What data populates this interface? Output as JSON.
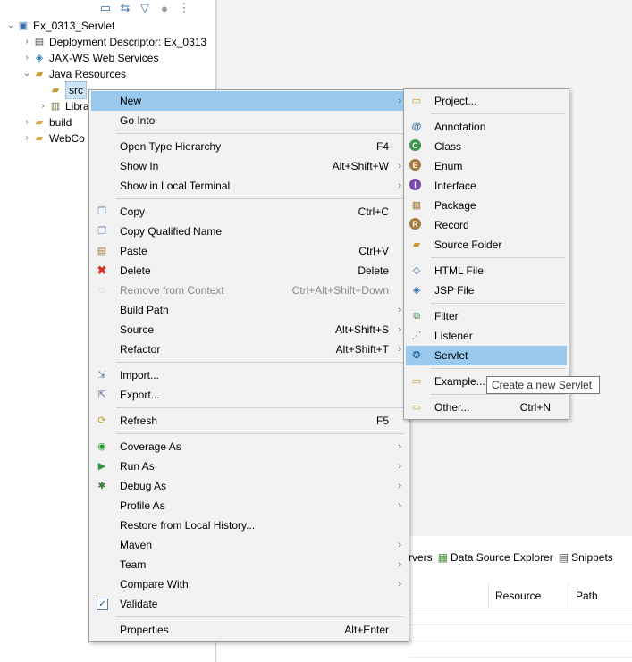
{
  "toolbar": {
    "icons": [
      "collapse-all-icon",
      "link-editor-icon",
      "filter-icon",
      "tree-icon",
      "view-menu-icon"
    ]
  },
  "tree": {
    "project": "Ex_0313_Servlet",
    "items": [
      {
        "label": "Deployment Descriptor: Ex_0313",
        "icon": "deployment-descriptor-icon"
      },
      {
        "label": "JAX-WS Web Services",
        "icon": "web-services-icon"
      },
      {
        "label": "Java Resources",
        "icon": "java-resources-icon"
      },
      {
        "label": "src",
        "icon": "package-folder-icon"
      },
      {
        "label": "Libra",
        "icon": "libraries-icon"
      },
      {
        "label": "build",
        "icon": "folder-icon"
      },
      {
        "label": "WebCo",
        "icon": "folder-icon"
      }
    ]
  },
  "context_menu": {
    "items": [
      {
        "label": "New",
        "shortcut": "",
        "submenu": true
      },
      {
        "label": "Go Into",
        "shortcut": ""
      },
      {
        "label": "Open Type Hierarchy",
        "shortcut": "F4"
      },
      {
        "label": "Show In",
        "shortcut": "Alt+Shift+W",
        "submenu": true
      },
      {
        "label": "Show in Local Terminal",
        "shortcut": "",
        "submenu": true
      },
      {
        "label": "Copy",
        "shortcut": "Ctrl+C"
      },
      {
        "label": "Copy Qualified Name",
        "shortcut": ""
      },
      {
        "label": "Paste",
        "shortcut": "Ctrl+V"
      },
      {
        "label": "Delete",
        "shortcut": "Delete"
      },
      {
        "label": "Remove from Context",
        "shortcut": "Ctrl+Alt+Shift+Down",
        "disabled": true
      },
      {
        "label": "Build Path",
        "shortcut": "",
        "submenu": true
      },
      {
        "label": "Source",
        "shortcut": "Alt+Shift+S",
        "submenu": true
      },
      {
        "label": "Refactor",
        "shortcut": "Alt+Shift+T",
        "submenu": true
      },
      {
        "label": "Import...",
        "shortcut": ""
      },
      {
        "label": "Export...",
        "shortcut": ""
      },
      {
        "label": "Refresh",
        "shortcut": "F5"
      },
      {
        "label": "Coverage As",
        "shortcut": "",
        "submenu": true
      },
      {
        "label": "Run As",
        "shortcut": "",
        "submenu": true
      },
      {
        "label": "Debug As",
        "shortcut": "",
        "submenu": true
      },
      {
        "label": "Profile As",
        "shortcut": "",
        "submenu": true
      },
      {
        "label": "Restore from Local History...",
        "shortcut": ""
      },
      {
        "label": "Maven",
        "shortcut": "",
        "submenu": true
      },
      {
        "label": "Team",
        "shortcut": "",
        "submenu": true
      },
      {
        "label": "Compare With",
        "shortcut": "",
        "submenu": true
      },
      {
        "label": "Validate",
        "shortcut": ""
      },
      {
        "label": "Properties",
        "shortcut": "Alt+Enter"
      }
    ]
  },
  "new_submenu": {
    "items": [
      {
        "label": "Project...",
        "shortcut": ""
      },
      {
        "label": "Annotation",
        "shortcut": ""
      },
      {
        "label": "Class",
        "shortcut": ""
      },
      {
        "label": "Enum",
        "shortcut": ""
      },
      {
        "label": "Interface",
        "shortcut": ""
      },
      {
        "label": "Package",
        "shortcut": ""
      },
      {
        "label": "Record",
        "shortcut": ""
      },
      {
        "label": "Source Folder",
        "shortcut": ""
      },
      {
        "label": "HTML File",
        "shortcut": ""
      },
      {
        "label": "JSP File",
        "shortcut": ""
      },
      {
        "label": "Filter",
        "shortcut": ""
      },
      {
        "label": "Listener",
        "shortcut": ""
      },
      {
        "label": "Servlet",
        "shortcut": ""
      },
      {
        "label": "Example...",
        "shortcut": ""
      },
      {
        "label": "Other...",
        "shortcut": "Ctrl+N"
      }
    ]
  },
  "tooltip": "Create a new Servlet",
  "bottom_tabs": [
    "rvers",
    "Data Source Explorer",
    "Snippets"
  ],
  "table_columns": [
    "Resource",
    "Path"
  ],
  "colors": {
    "highlight": "#99c9ef",
    "menu_bg": "#f2f2f2"
  }
}
